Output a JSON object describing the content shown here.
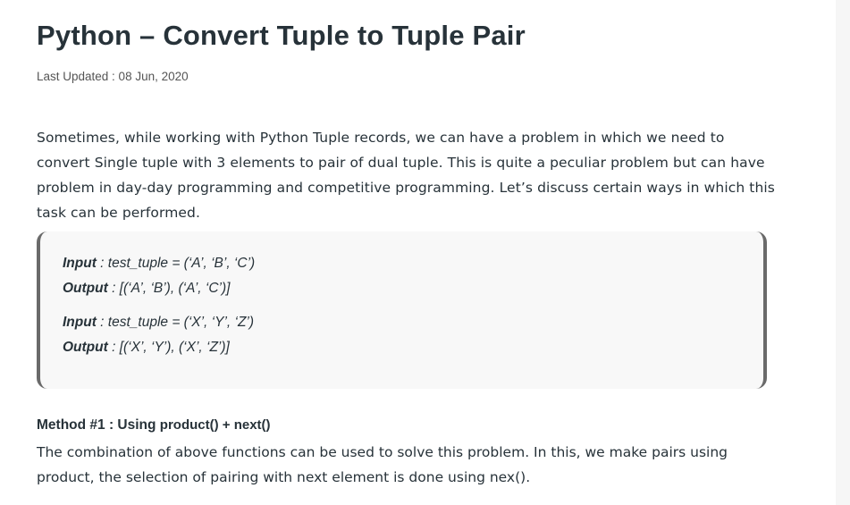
{
  "article": {
    "title": "Python – Convert Tuple to Tuple Pair",
    "last_updated": "Last Updated : 08 Jun, 2020",
    "intro": "Sometimes, while working with Python Tuple records, we can have a problem in which we need to convert Single tuple with 3 elements to pair of dual tuple. This is quite a peculiar problem but can have problem in day-day programming and competitive programming. Let’s discuss certain ways in which this task can be performed.",
    "examples": [
      {
        "input_label": "Input",
        "input": " : test_tuple = (‘A’, ‘B’, ‘C’)",
        "output_label": "Output",
        "output": " : [(‘A’, ‘B’), (‘A’, ‘C’)]"
      },
      {
        "input_label": "Input",
        "input": " : test_tuple = (‘X’, ‘Y’, ‘Z’)",
        "output_label": "Output",
        "output": " : [(‘X’, ‘Y’), (‘X’, ‘Z’)]"
      }
    ],
    "method1_heading": "Method #1 : Using ",
    "method1_fn": "product() + next()",
    "method1_text": "The combination of above functions can be used to solve this problem. In this, we make pairs using product, the selection of pairing with next element is done using nex()."
  }
}
